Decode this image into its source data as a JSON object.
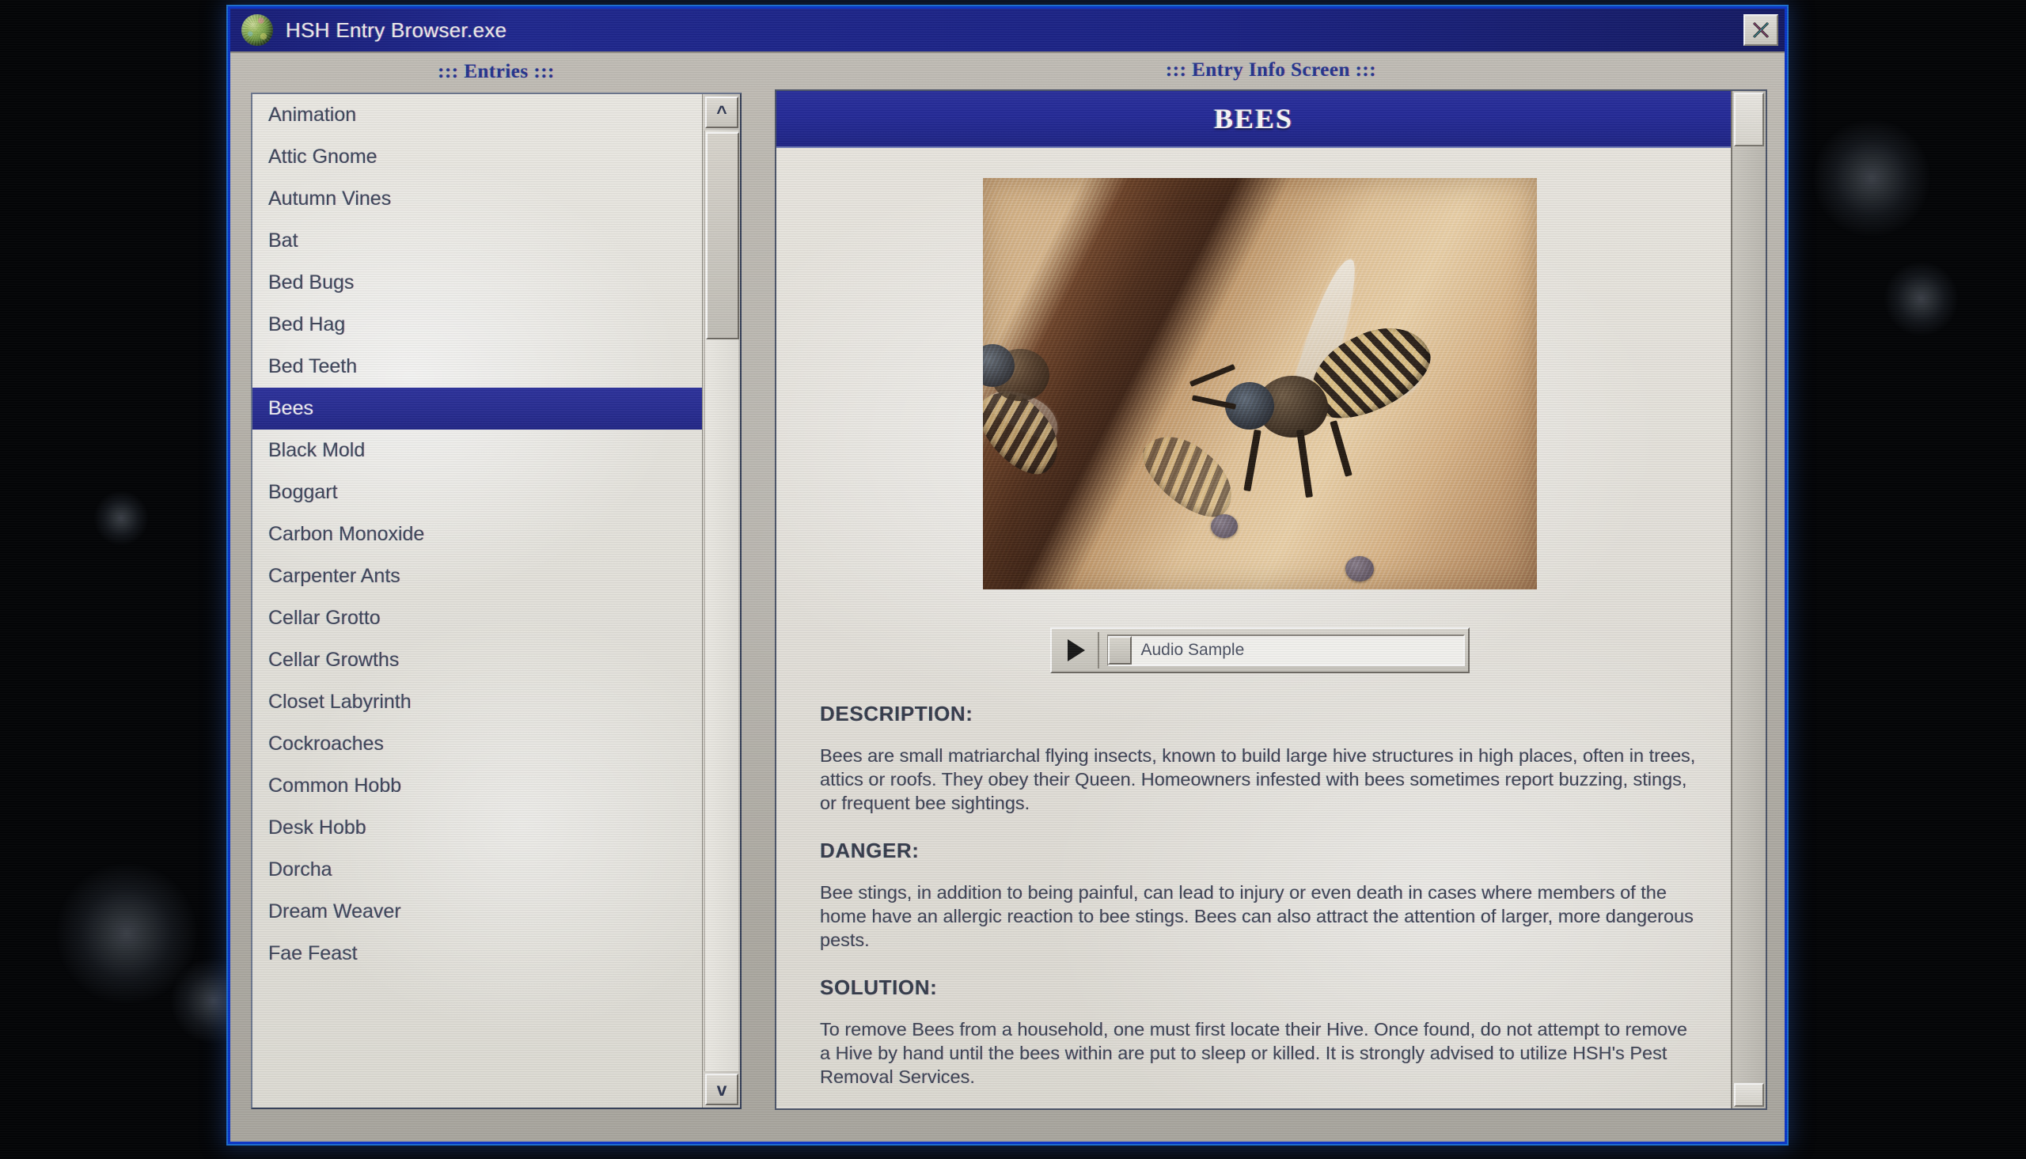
{
  "window": {
    "title": "HSH Entry Browser.exe",
    "icon": "green-sphere-icon",
    "close_label": "X"
  },
  "panels": {
    "entries_heading": "::: Entries :::",
    "info_heading": "::: Entry Info Screen :::"
  },
  "entries": {
    "selected": "Bees",
    "items": [
      {
        "label": "Animation"
      },
      {
        "label": "Attic Gnome"
      },
      {
        "label": "Autumn Vines"
      },
      {
        "label": "Bat"
      },
      {
        "label": "Bed Bugs"
      },
      {
        "label": "Bed Hag"
      },
      {
        "label": "Bed Teeth"
      },
      {
        "label": "Bees"
      },
      {
        "label": "Black Mold"
      },
      {
        "label": "Boggart"
      },
      {
        "label": "Carbon Monoxide"
      },
      {
        "label": "Carpenter Ants"
      },
      {
        "label": "Cellar Grotto"
      },
      {
        "label": "Cellar Growths"
      },
      {
        "label": "Closet Labyrinth"
      },
      {
        "label": "Cockroaches"
      },
      {
        "label": "Common Hobb"
      },
      {
        "label": "Desk Hobb"
      },
      {
        "label": "Dorcha"
      },
      {
        "label": "Dream Weaver"
      },
      {
        "label": "Fae Feast"
      }
    ],
    "scroll_up_glyph": "^",
    "scroll_down_glyph": "v"
  },
  "entry": {
    "title": "BEES",
    "photo_alt": "two-bees-on-wooden-plank",
    "audio": {
      "play_glyph": "play-triangle",
      "label": "Audio Sample"
    },
    "sections": [
      {
        "heading": "DESCRIPTION:",
        "body": "Bees are small matriarchal flying insects, known to build large hive structures in high places, often in trees, attics or roofs. They obey their Queen. Homeowners infested with bees sometimes report buzzing, stings, or frequent bee sightings."
      },
      {
        "heading": "DANGER:",
        "body": "Bee stings, in addition to being painful, can lead to injury or even death in cases where members of the home have an allergic reaction to bee stings. Bees can also attract the attention of larger, more dangerous pests."
      },
      {
        "heading": "SOLUTION:",
        "body": "To remove Bees from a household, one must first locate their Hive. Once found, do not attempt to remove a Hive by hand until the bees within are put to sleep or killed. It is strongly advised to utilize HSH's Pest Removal Services."
      }
    ]
  },
  "colors": {
    "titlebar_blue": "#1b2490",
    "window_border_blue": "#0b35c8",
    "selection_blue": "#252a95",
    "heading_blue": "#22318f",
    "panel_gray": "#b4b0a8",
    "list_bg": "#eceae3"
  }
}
